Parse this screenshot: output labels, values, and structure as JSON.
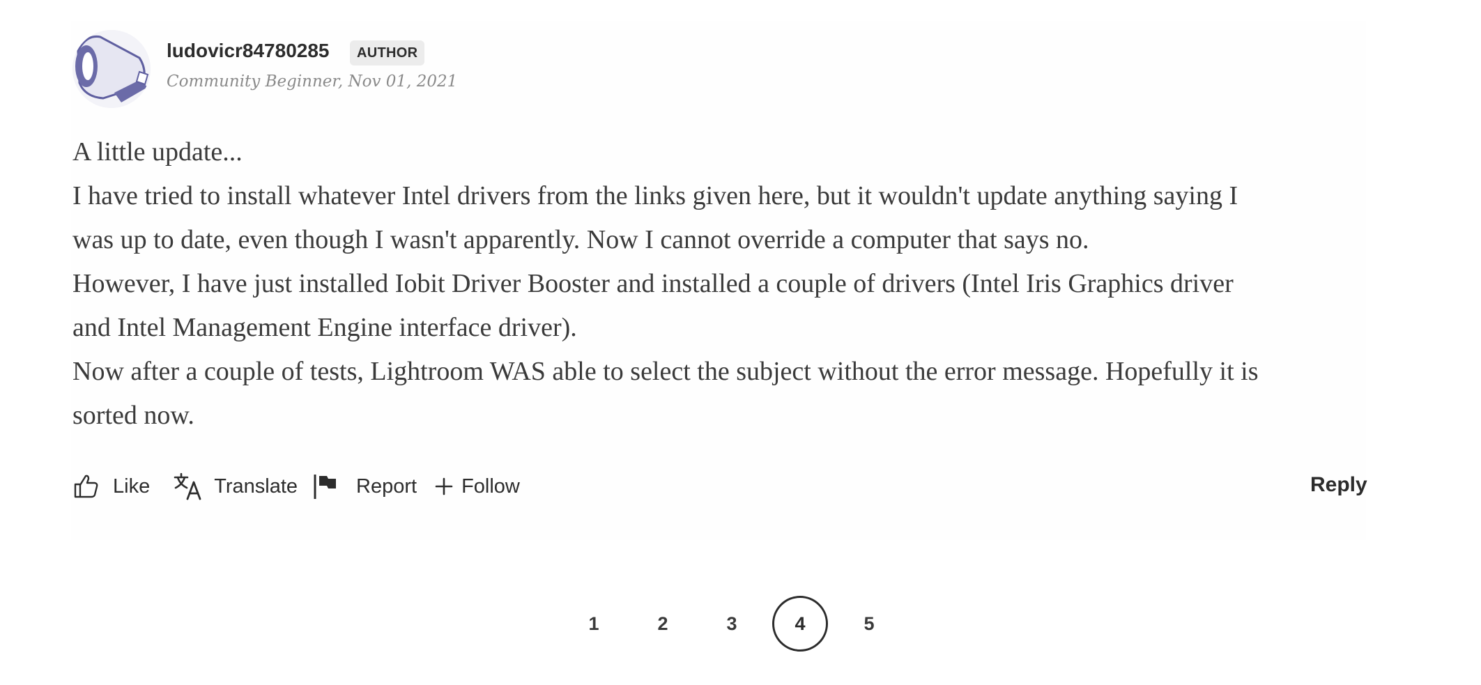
{
  "author": {
    "name": "ludovicr84780285",
    "badge": "AUTHOR",
    "rank": "Community Beginner",
    "date_separator": ",",
    "date": "Nov 01, 2021"
  },
  "post": {
    "paragraphs": [
      "A little update...",
      "I have tried to install whatever Intel drivers from the links given here, but it wouldn't update anything saying I",
      "was up to date, even though I wasn't apparently. Now I cannot override a computer that says no.",
      "However, I have just installed Iobit Driver Booster and installed a couple of drivers (Intel Iris Graphics driver",
      "and Intel Management Engine interface driver).",
      "Now after a couple of tests, Lightroom WAS able to select the subject without the error message. Hopefully it is",
      "sorted now."
    ]
  },
  "actions": {
    "like": "Like",
    "translate": "Translate",
    "report": "Report",
    "follow": "Follow",
    "reply": "Reply"
  },
  "pagination": {
    "pages": [
      "1",
      "2",
      "3",
      "4",
      "5"
    ],
    "current": "4"
  },
  "colors": {
    "text": "#2c2c2c",
    "muted": "#8a8a8a",
    "badge_bg": "#ececec",
    "avatar_accent": "#6b6ba8"
  }
}
